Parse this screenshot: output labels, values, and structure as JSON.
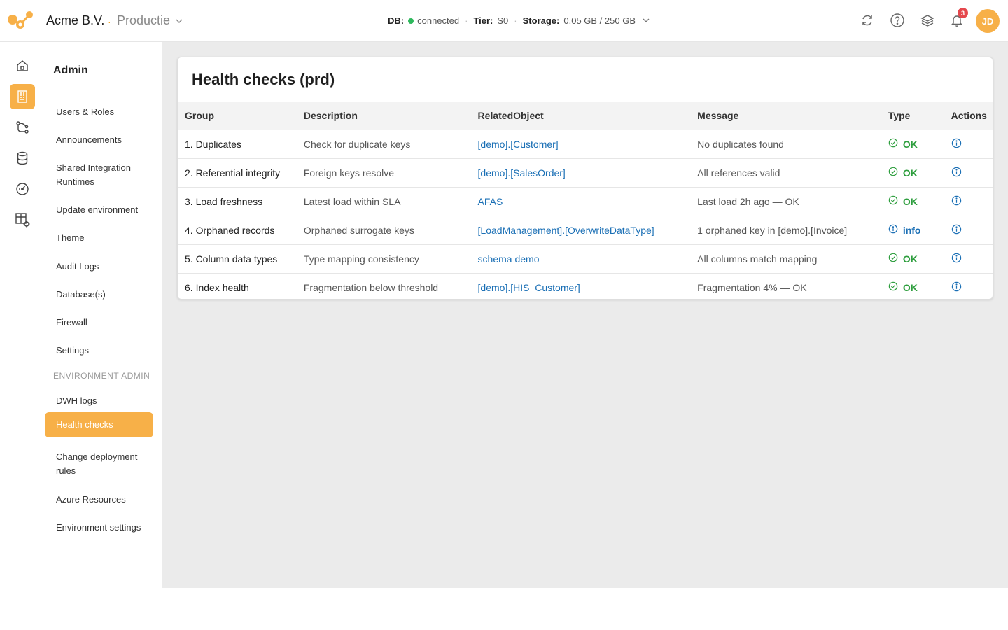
{
  "header": {
    "company": "Acme B.V.",
    "separator": "·",
    "environment": "Productie",
    "db_label": "DB:",
    "db_status": "connected",
    "tier_label": "Tier:",
    "tier_value": "S0",
    "storage_label": "Storage:",
    "storage_value": "0.05 GB / 250 GB",
    "notification_count": "3",
    "avatar_initials": "JD",
    "icons": [
      "refresh-icon",
      "help-icon",
      "layers-icon",
      "bell-icon"
    ]
  },
  "rail": {
    "items": [
      "home-icon",
      "building-icon",
      "pipeline-icon",
      "database-icon",
      "gauge-icon",
      "table-settings-icon"
    ],
    "active_index": 1
  },
  "sidebar": {
    "title": "Admin",
    "items": [
      {
        "label": "Users & Roles"
      },
      {
        "label": "Announcements"
      },
      {
        "label": "Shared Integration Runtimes"
      },
      {
        "label": "Update environment"
      },
      {
        "label": "Theme"
      },
      {
        "label": "Audit Logs"
      },
      {
        "label": "Database(s)"
      },
      {
        "label": "Firewall"
      },
      {
        "label": "Settings"
      }
    ],
    "section_title": "ENVIRONMENT ADMIN",
    "env_items": [
      {
        "label": "DWH logs"
      },
      {
        "label": "Health checks",
        "active": true
      },
      {
        "label": "Change deployment rules"
      },
      {
        "label": "Azure Resources"
      },
      {
        "label": "Environment settings"
      }
    ]
  },
  "main": {
    "title": "Health checks (prd)",
    "columns": [
      "Group",
      "Description",
      "RelatedObject",
      "Message",
      "Type",
      "Actions"
    ],
    "rows": [
      {
        "group": "1. Duplicates",
        "description": "Check for duplicate keys",
        "related": "[demo].[Customer]",
        "message": "No duplicates found",
        "type": "OK",
        "status": "ok"
      },
      {
        "group": "2. Referential integrity",
        "description": "Foreign keys resolve",
        "related": "[demo].[SalesOrder]",
        "message": "All references valid",
        "type": "OK",
        "status": "ok"
      },
      {
        "group": "3. Load freshness",
        "description": "Latest load within SLA",
        "related": "AFAS",
        "message": "Last load 2h ago — OK",
        "type": "OK",
        "status": "ok"
      },
      {
        "group": "4. Orphaned records",
        "description": "Orphaned surrogate keys",
        "related": "[LoadManagement].[OverwriteDataType]",
        "message": "1 orphaned key in [demo].[Invoice]",
        "type": "info",
        "status": "info"
      },
      {
        "group": "5. Column data types",
        "description": "Type mapping consistency",
        "related": "schema demo",
        "message": "All columns match mapping",
        "type": "OK",
        "status": "ok"
      },
      {
        "group": "6. Index health",
        "description": "Fragmentation below threshold",
        "related": "[demo].[HIS_Customer]",
        "message": "Fragmentation 4% — OK",
        "type": "OK",
        "status": "ok"
      }
    ]
  },
  "colors": {
    "accent": "#f7b048",
    "ok": "#2e9e3e",
    "info": "#1a6fb5",
    "connected": "#2eb85c",
    "badge": "#e5484d"
  }
}
